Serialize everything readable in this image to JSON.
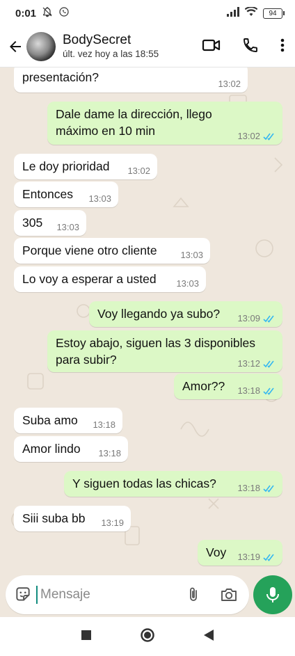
{
  "status_bar": {
    "time": "0:01",
    "battery": "94",
    "icons": [
      "mute-bell-icon",
      "whatsapp-icon",
      "signal-icon",
      "wifi-icon",
      "battery-icon"
    ]
  },
  "header": {
    "contact_name": "BodySecret",
    "last_seen": "últ. vez hoy a las 18:55",
    "icons": [
      "back-arrow-icon",
      "video-call-icon",
      "phone-icon",
      "more-vert-icon"
    ]
  },
  "messages": [
    {
      "id": "m0",
      "dir": "in",
      "text": "presentación?",
      "time": "13:02"
    },
    {
      "id": "m1",
      "dir": "out",
      "text": "Dale dame la dirección, llego máximo en 10 min",
      "time": "13:02"
    },
    {
      "id": "m2",
      "dir": "in",
      "text": "Le doy prioridad",
      "time": "13:02"
    },
    {
      "id": "m3",
      "dir": "in",
      "text": "Entonces",
      "time": "13:03"
    },
    {
      "id": "m4",
      "dir": "in",
      "text": "305",
      "time": "13:03"
    },
    {
      "id": "m5",
      "dir": "in",
      "text": "Porque viene otro cliente",
      "time": "13:03"
    },
    {
      "id": "m6",
      "dir": "in",
      "text": "Lo voy a esperar a usted",
      "time": "13:03"
    },
    {
      "id": "m7",
      "dir": "out",
      "text": "Voy llegando ya subo?",
      "time": "13:09"
    },
    {
      "id": "m8",
      "dir": "out",
      "text": "Estoy abajo, siguen las 3 disponibles para subir?",
      "time": "13:12"
    },
    {
      "id": "m9",
      "dir": "out",
      "text": "Amor??",
      "time": "13:18"
    },
    {
      "id": "m10",
      "dir": "in",
      "text": "Suba amo",
      "time": "13:18"
    },
    {
      "id": "m11",
      "dir": "in",
      "text": "Amor lindo",
      "time": "13:18"
    },
    {
      "id": "m12",
      "dir": "out",
      "text": "Y siguen todas las chicas?",
      "time": "13:18"
    },
    {
      "id": "m13",
      "dir": "in",
      "text": "Siii suba bb",
      "time": "13:19"
    },
    {
      "id": "m14",
      "dir": "out",
      "text": "Voy",
      "time": "13:19"
    }
  ],
  "composer": {
    "placeholder": "Mensaje",
    "icons": [
      "sticker-icon",
      "attach-icon",
      "camera-icon",
      "mic-icon"
    ]
  },
  "nav_bar": {
    "icons": [
      "recents-square-icon",
      "home-circle-icon",
      "back-triangle-icon"
    ]
  },
  "colors": {
    "chat_background": "#efe7dd",
    "outgoing_bubble": "#dcf8c6",
    "incoming_bubble": "#ffffff",
    "read_ticks": "#34b7f1",
    "mic_button": "#25a25a"
  }
}
